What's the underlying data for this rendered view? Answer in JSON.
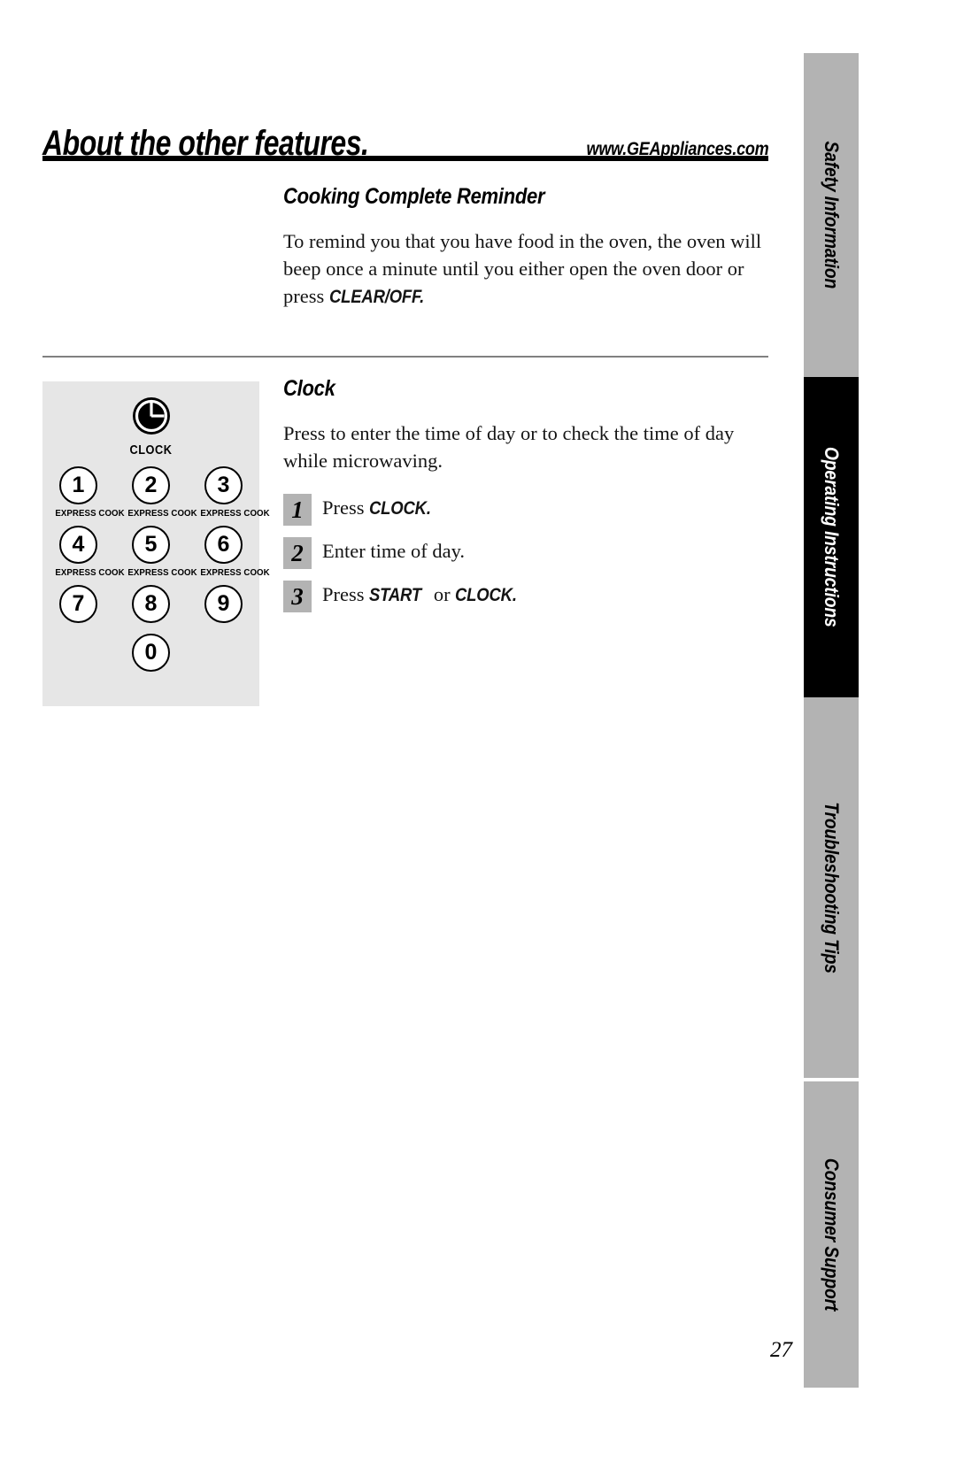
{
  "header": {
    "title": "About the other features.",
    "url": "www.GEAppliances.com"
  },
  "sections": {
    "reminder": {
      "heading": "Cooking Complete Reminder",
      "body_part1": "To remind you that you have food in the oven, the oven will beep once a minute until you either open the oven door or press ",
      "body_keyword": "CLEAR/OFF.",
      "body_part2": ""
    },
    "clock": {
      "heading": "Clock",
      "intro": "Press to enter the time of day or to check the time of day while microwaving.",
      "steps": [
        {
          "number": "1",
          "text_before": "Press ",
          "keyword": "CLOCK.",
          "text_after": ""
        },
        {
          "number": "2",
          "text_before": "Enter time of day.",
          "keyword": "",
          "text_after": ""
        },
        {
          "number": "3",
          "text_before": "Press ",
          "keyword": "START",
          "text_middle": " or ",
          "keyword2": "CLOCK.",
          "text_after": ""
        }
      ]
    }
  },
  "keypad": {
    "clock_button_label": "CLOCK",
    "clock_icon": "clock-icon",
    "express_cook_label": "EXPRESS COOK",
    "rows": [
      [
        {
          "digit": "1",
          "sub": "EXPRESS COOK"
        },
        {
          "digit": "2",
          "sub": "EXPRESS COOK"
        },
        {
          "digit": "3",
          "sub": "EXPRESS COOK"
        }
      ],
      [
        {
          "digit": "4",
          "sub": "EXPRESS COOK"
        },
        {
          "digit": "5",
          "sub": "EXPRESS COOK"
        },
        {
          "digit": "6",
          "sub": "EXPRESS COOK"
        }
      ],
      [
        {
          "digit": "7",
          "sub": ""
        },
        {
          "digit": "8",
          "sub": ""
        },
        {
          "digit": "9",
          "sub": ""
        }
      ],
      [
        {
          "digit": "0",
          "sub": ""
        }
      ]
    ]
  },
  "rail": {
    "tabs": [
      {
        "label": "Safety Information",
        "active": false
      },
      {
        "label": "Operating Instructions",
        "active": true
      },
      {
        "label": "Troubleshooting Tips",
        "active": false
      },
      {
        "label": "Consumer Support",
        "active": false
      }
    ]
  },
  "footer": {
    "page_number": "27"
  },
  "colors": {
    "tab_inactive": "#b3b3b3",
    "tab_active": "#000000",
    "keypad_panel": "#e6e6e6",
    "step_box": "#b3b3b3"
  }
}
